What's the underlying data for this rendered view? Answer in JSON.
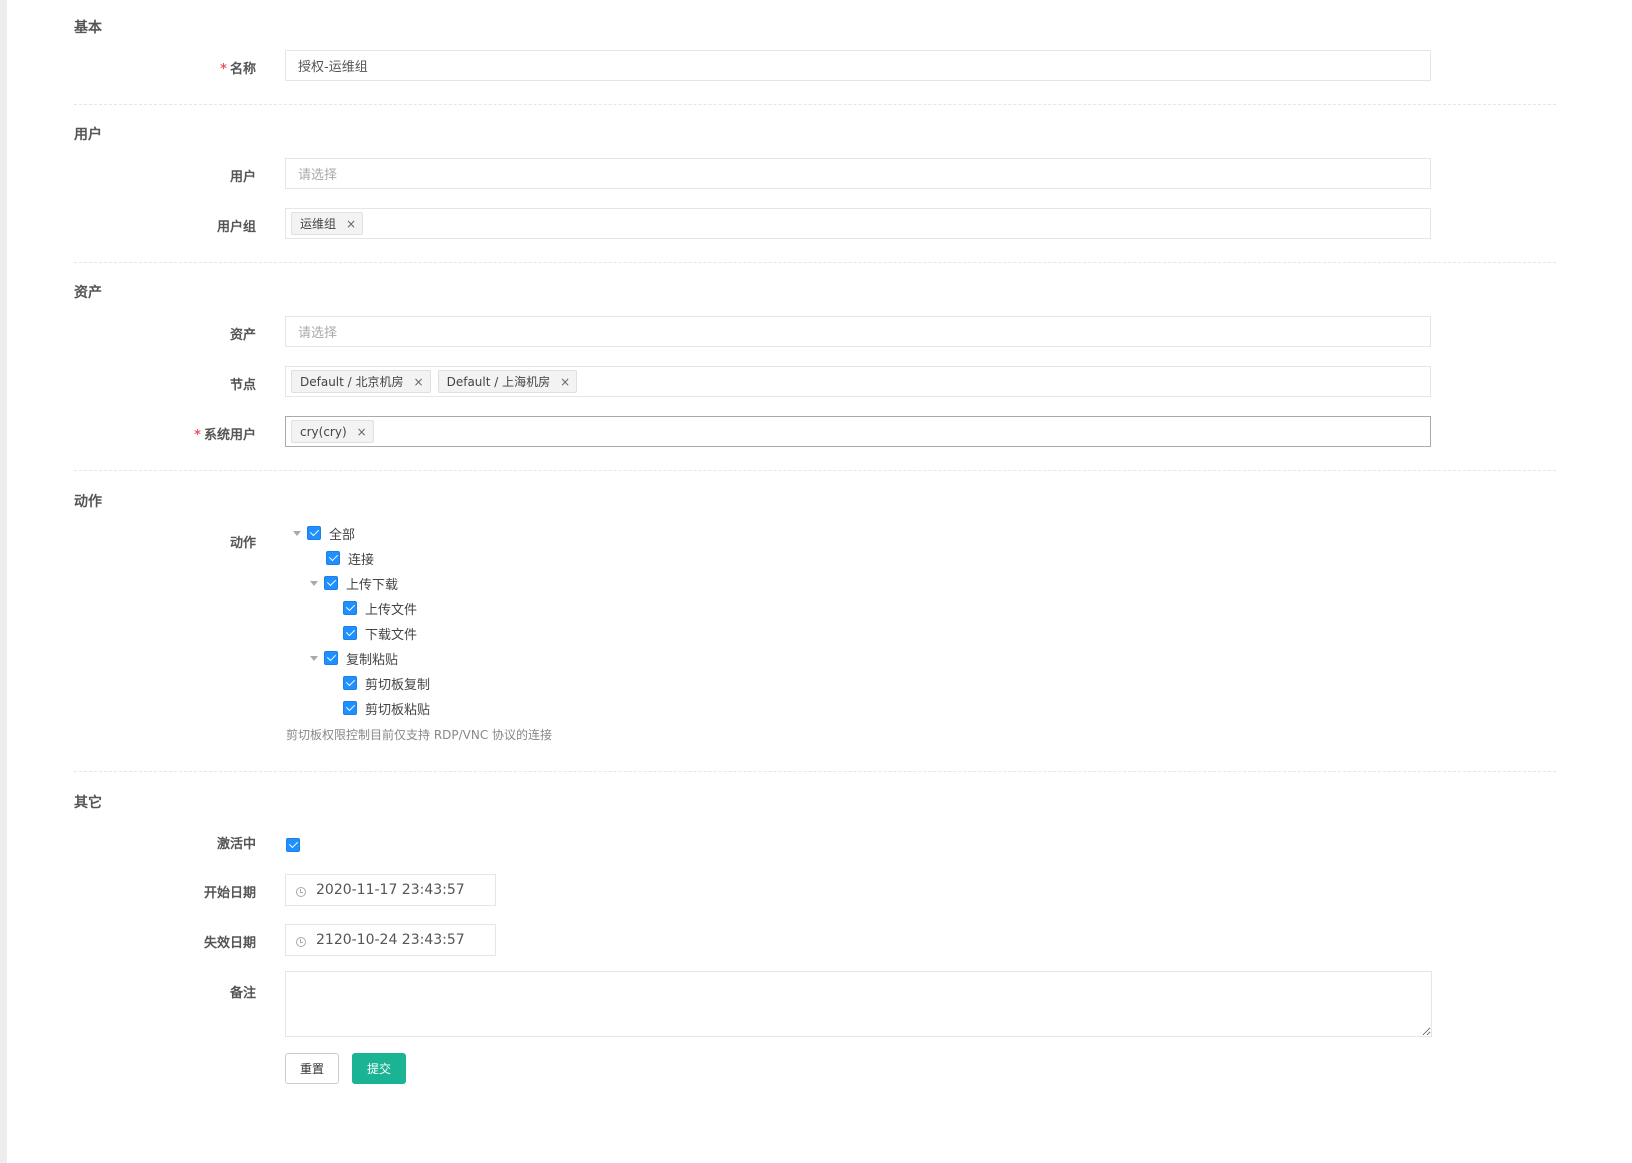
{
  "sections": {
    "basic": "基本",
    "user": "用户",
    "asset": "资产",
    "action": "动作",
    "other": "其它"
  },
  "basic": {
    "name_label": "名称",
    "name_value": "授权-运维组"
  },
  "user": {
    "users_label": "用户",
    "users_placeholder": "请选择",
    "groups_label": "用户组",
    "groups_tags": [
      "运维组"
    ]
  },
  "asset": {
    "assets_label": "资产",
    "assets_placeholder": "请选择",
    "nodes_label": "节点",
    "nodes_tags": [
      "Default / 北京机房",
      "Default / 上海机房"
    ],
    "system_user_label": "系统用户",
    "system_user_tags": [
      "cry(cry)"
    ]
  },
  "action": {
    "label": "动作",
    "tree": {
      "all": "全部",
      "connect": "连接",
      "transfer": "上传下载",
      "upload": "上传文件",
      "download": "下载文件",
      "clipboard": "复制粘贴",
      "clipboard_copy": "剪切板复制",
      "clipboard_paste": "剪切板粘贴"
    },
    "help_text": "剪切板权限控制目前仅支持 RDP/VNC 协议的连接"
  },
  "other": {
    "active_label": "激活中",
    "active_checked": true,
    "start_label": "开始日期",
    "start_value": "2020-11-17 23:43:57",
    "end_label": "失效日期",
    "end_value": "2120-10-24 23:43:57",
    "comment_label": "备注",
    "comment_value": ""
  },
  "buttons": {
    "reset": "重置",
    "submit": "提交"
  },
  "colors": {
    "primary": "#1ab394",
    "checkbox": "#1e90ff",
    "required": "#ed5565"
  }
}
